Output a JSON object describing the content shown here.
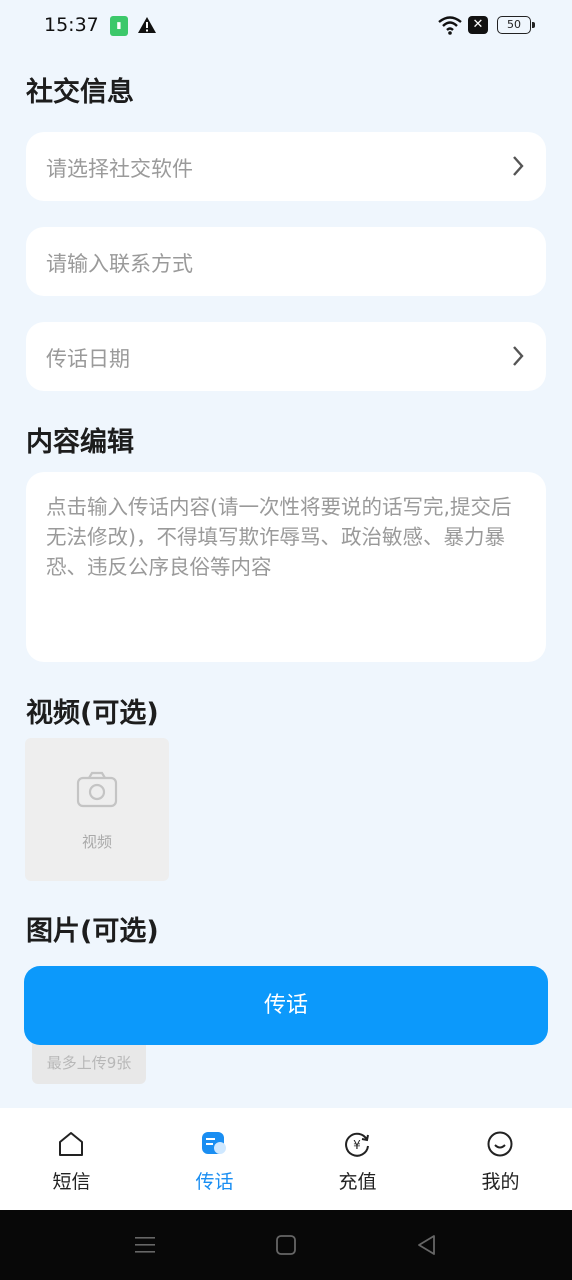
{
  "status_bar": {
    "time": "15:37",
    "sim_label": "",
    "nfc_label": "✕",
    "battery": "50"
  },
  "social": {
    "title": "社交信息",
    "app_select": "请选择社交软件",
    "contact_input": "请输入联系方式",
    "date_select": "传话日期"
  },
  "content": {
    "title": "内容编辑",
    "placeholder": "点击输入传话内容(请一次性将要说的话写完,提交后无法修改)，不得填写欺诈辱骂、政治敏感、暴力暴恐、违反公序良俗等内容"
  },
  "video": {
    "title": "视频(可选)",
    "label": "视频"
  },
  "image": {
    "title": "图片(可选)",
    "limit": "最多上传9张"
  },
  "submit_label": "传话",
  "nav": {
    "items": [
      {
        "label": "短信",
        "icon": "home-icon"
      },
      {
        "label": "传话",
        "icon": "message-icon",
        "active": true
      },
      {
        "label": "充值",
        "icon": "yuan-refresh-icon"
      },
      {
        "label": "我的",
        "icon": "smile-icon"
      }
    ]
  },
  "colors": {
    "accent": "#0c99fb",
    "nav_active": "#1a8ef2",
    "background": "#eff6fd"
  }
}
